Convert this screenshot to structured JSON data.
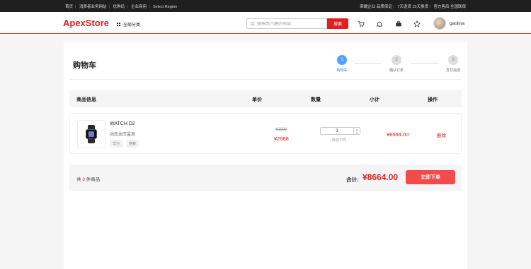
{
  "topbar": {
    "left_links": [
      "首页",
      "消费者业务网站",
      "优购码",
      "企业商用",
      "Select Region"
    ],
    "right_items": [
      "荣耀企业 品质保证",
      "7天退货 15天换货",
      "官方售后 全国联保"
    ]
  },
  "header": {
    "logo": "ApexStore",
    "all_categories": "全部分类",
    "search_placeholder": "搜索感兴趣的商品",
    "search_button": "搜索",
    "username": "gaolina"
  },
  "page": {
    "title": "购物车",
    "steps": [
      {
        "num": "1",
        "label": "购物车",
        "state": "active"
      },
      {
        "num": "2",
        "label": "确认订单",
        "state": "todo"
      },
      {
        "num": "3",
        "label": "支付完成",
        "state": "todo"
      }
    ]
  },
  "table": {
    "headers": {
      "product": "商品信息",
      "unit_price": "单价",
      "qty": "数量",
      "subtotal": "小计",
      "action": "操作"
    }
  },
  "item": {
    "name": "WATCH D2",
    "desc": "动态血压监测",
    "tags": [
      "华为",
      "穿戴"
    ],
    "original_price": "¥2900",
    "price": "¥2888",
    "quantity": "3",
    "stock": "库存77件",
    "subtotal": "¥8664.00",
    "delete": "删除"
  },
  "summary": {
    "count_prefix": "共",
    "count": "3",
    "count_suffix": "件商品",
    "total_label": "合计:",
    "total": "¥8664.00",
    "order_button": "立即下单"
  },
  "colors": {
    "brand": "#e02020",
    "step_active": "#4da3ff",
    "order_button": "#f24b4b"
  }
}
